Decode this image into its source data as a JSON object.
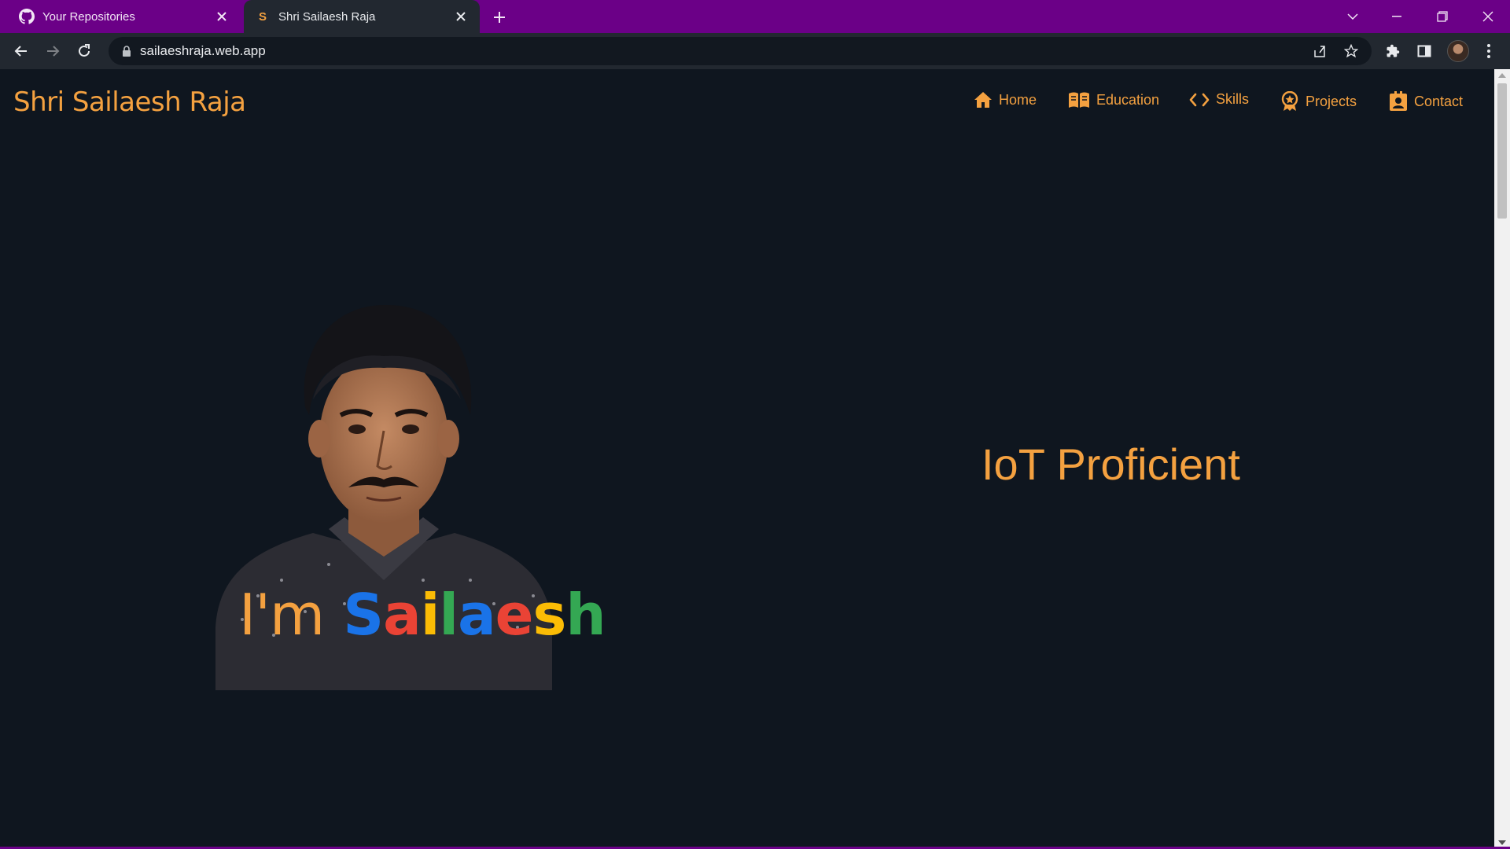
{
  "browser": {
    "tabs": [
      {
        "title": "Your Repositories",
        "favicon": "github-icon",
        "active": false
      },
      {
        "title": "Shri Sailaesh Raja",
        "favicon": "S",
        "active": true
      }
    ],
    "url": "sailaeshraja.web.app"
  },
  "site": {
    "brand": "Shri Sailaesh Raja",
    "nav": [
      {
        "label": "Home",
        "icon": "home-icon"
      },
      {
        "label": "Education",
        "icon": "book-icon"
      },
      {
        "label": "Skills",
        "icon": "code-icon"
      },
      {
        "label": "Projects",
        "icon": "award-icon"
      },
      {
        "label": "Contact",
        "icon": "contact-card-icon"
      }
    ],
    "hero": {
      "greeting": "I'm",
      "name_letters": [
        {
          "ch": "S",
          "color": "#1a73e8"
        },
        {
          "ch": "a",
          "color": "#ea4335"
        },
        {
          "ch": "i",
          "color": "#fbbc05"
        },
        {
          "ch": "l",
          "color": "#34a853"
        },
        {
          "ch": "a",
          "color": "#1a73e8"
        },
        {
          "ch": "e",
          "color": "#ea4335"
        },
        {
          "ch": "s",
          "color": "#fbbc05"
        },
        {
          "ch": "h",
          "color": "#34a853"
        }
      ],
      "role": "IoT Proficient"
    },
    "colors": {
      "accent": "#f4a140",
      "background": "#0f161f",
      "chrome": "#6b0087"
    }
  }
}
